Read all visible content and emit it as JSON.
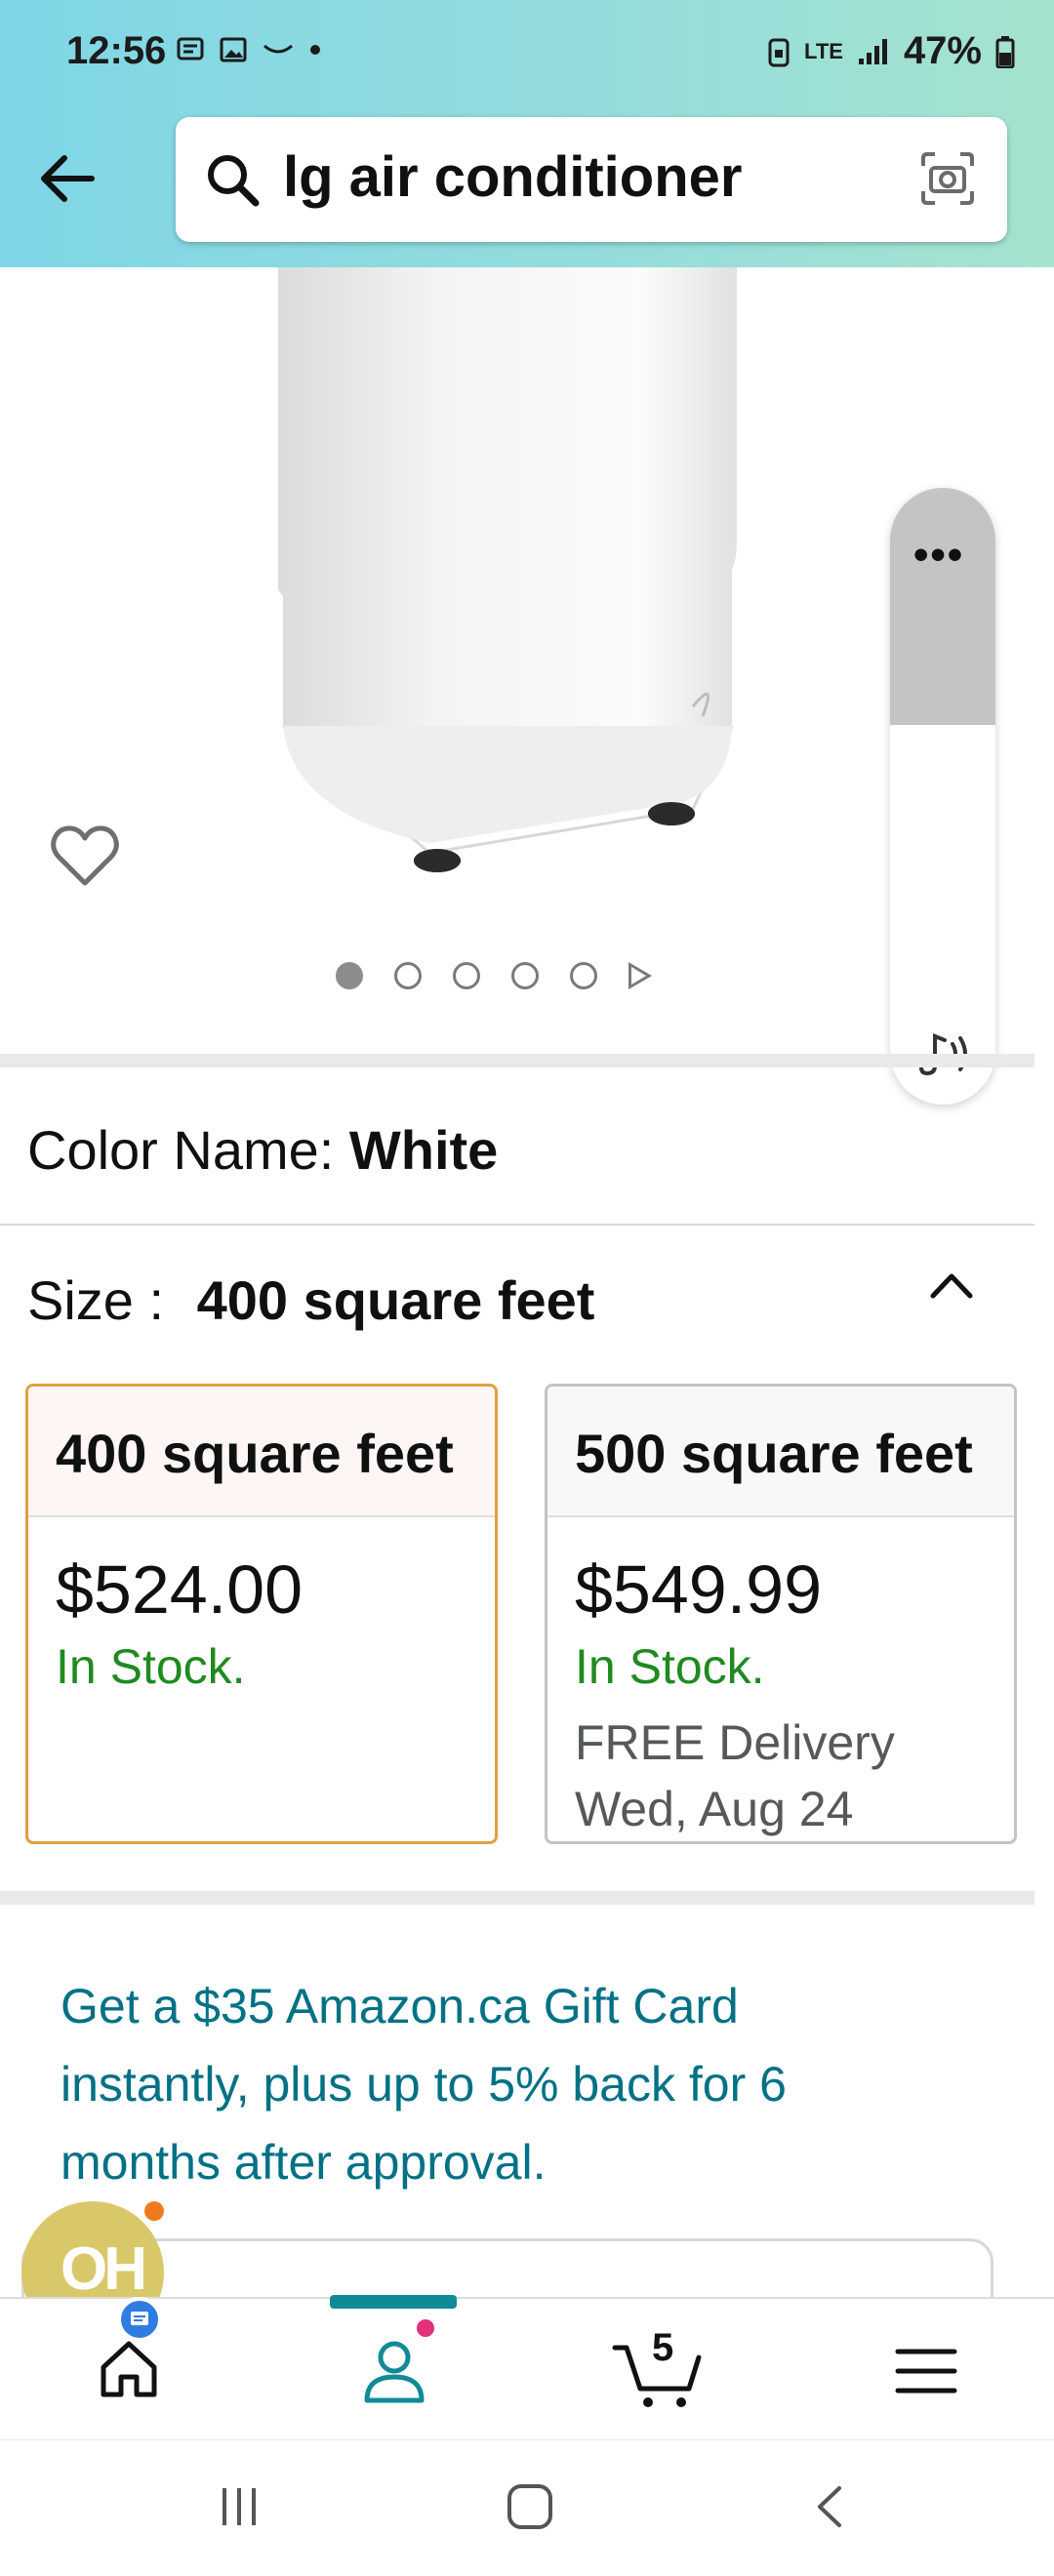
{
  "status_bar": {
    "time": "12:56",
    "network": "LTE",
    "battery": "47%"
  },
  "search": {
    "query": "lg air conditioner"
  },
  "product": {
    "image_dots": 5,
    "active_dot": 1
  },
  "variation": {
    "color_label": "Color Name:",
    "color_value": "White",
    "size_label": "Size :",
    "size_value": "400 square feet"
  },
  "size_options": [
    {
      "label": "400 square feet",
      "price": "$524.00",
      "stock": "In Stock.",
      "delivery": "",
      "date": "",
      "selected": true
    },
    {
      "label": "500 square feet",
      "price": "$549.99",
      "stock": "In Stock.",
      "delivery": "FREE Delivery",
      "date": "Wed, Aug 24",
      "selected": false
    }
  ],
  "promo": {
    "text": "Get a $35 Amazon.ca Gift Card instantly, plus up to 5% back for 6 months after approval."
  },
  "bubble": {
    "text": "OH"
  },
  "bottom_nav": {
    "cart_count": "5"
  },
  "colors": {
    "accent_teal": "#007185",
    "in_stock_green": "#1f8a1f",
    "selected_border": "#e09f3e",
    "nav_indicator": "#0f8a96"
  }
}
